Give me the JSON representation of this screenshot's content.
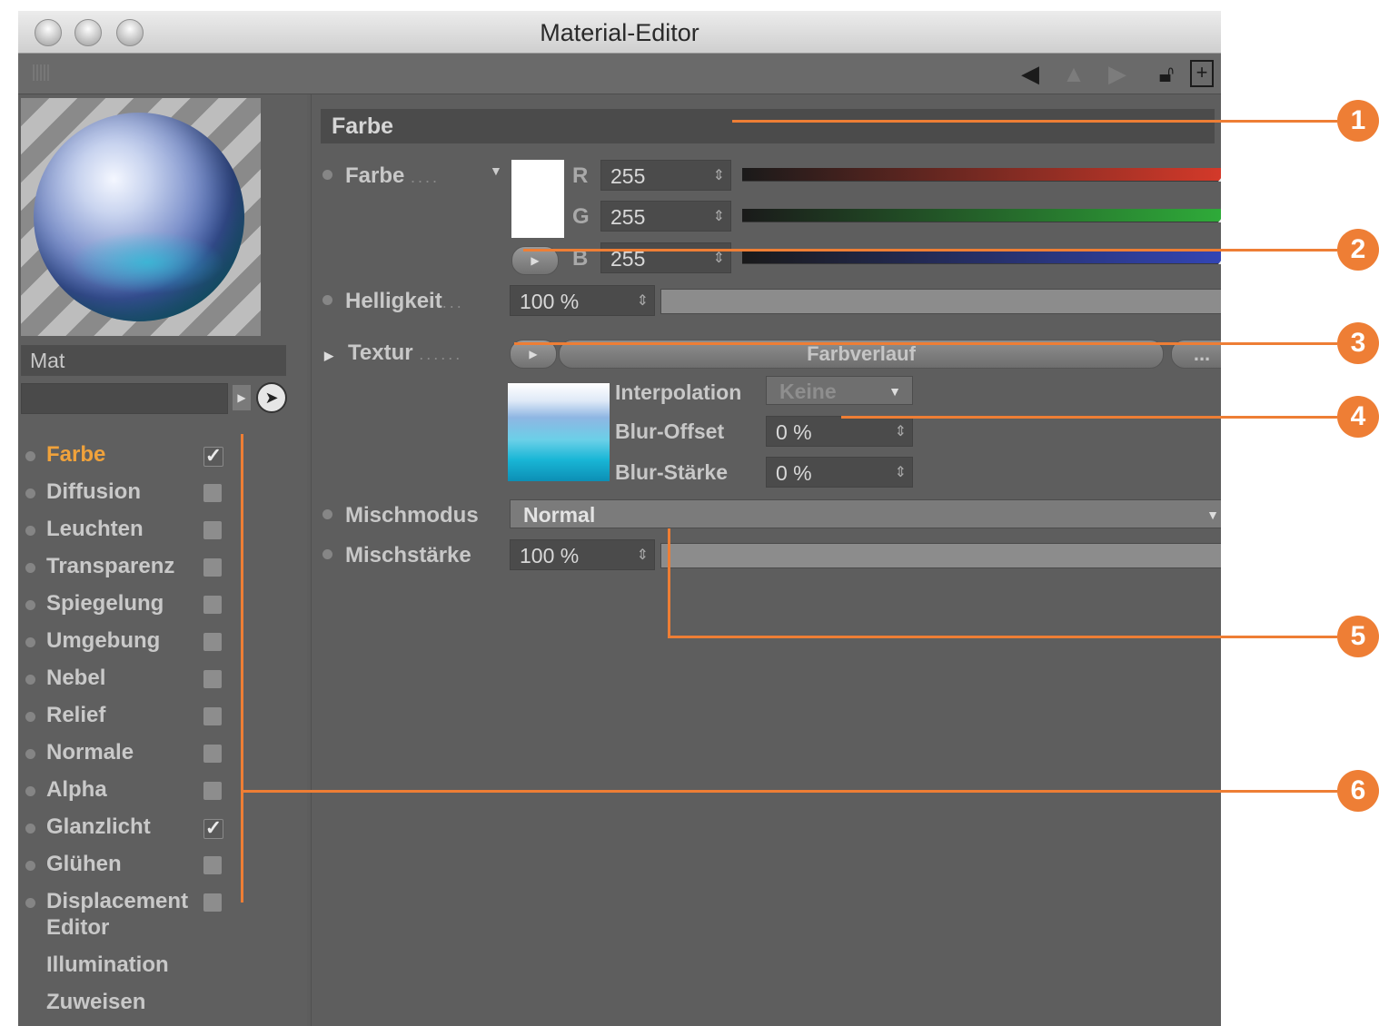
{
  "window": {
    "title": "Material-Editor"
  },
  "preview": {
    "material_name": "Mat"
  },
  "channels": [
    {
      "label": "Farbe",
      "checked": true,
      "active": true
    },
    {
      "label": "Diffusion",
      "checked": false
    },
    {
      "label": "Leuchten",
      "checked": false
    },
    {
      "label": "Transparenz",
      "checked": false
    },
    {
      "label": "Spiegelung",
      "checked": false
    },
    {
      "label": "Umgebung",
      "checked": false
    },
    {
      "label": "Nebel",
      "checked": false
    },
    {
      "label": "Relief",
      "checked": false
    },
    {
      "label": "Normale",
      "checked": false
    },
    {
      "label": "Alpha",
      "checked": false
    },
    {
      "label": "Glanzlicht",
      "checked": true
    },
    {
      "label": "Glühen",
      "checked": false
    },
    {
      "label": "Displacement",
      "checked": false
    }
  ],
  "extra_items": [
    "Editor",
    "Illumination",
    "Zuweisen"
  ],
  "panel": {
    "section_title": "Farbe",
    "color": {
      "label": "Farbe",
      "r_label": "R",
      "r_value": "255",
      "g_label": "G",
      "g_value": "255",
      "b_label": "B",
      "b_value": "255"
    },
    "brightness": {
      "label": "Helligkeit",
      "value": "100 %",
      "fraction": 1.0
    },
    "texture": {
      "label": "Textur",
      "name": "Farbverlauf",
      "more_label": "...",
      "interpolation_label": "Interpolation",
      "interpolation_value": "Keine",
      "blur_offset_label": "Blur-Offset",
      "blur_offset_value": "0 %",
      "blur_strength_label": "Blur-Stärke",
      "blur_strength_value": "0 %"
    },
    "mix_mode": {
      "label": "Mischmodus",
      "value": "Normal"
    },
    "mix_strength": {
      "label": "Mischstärke",
      "value": "100 %",
      "fraction": 1.0
    }
  },
  "callouts": [
    "1",
    "2",
    "3",
    "4",
    "5",
    "6"
  ],
  "colors": {
    "accent": "#ee7e35",
    "active_channel": "#f0a23b"
  }
}
